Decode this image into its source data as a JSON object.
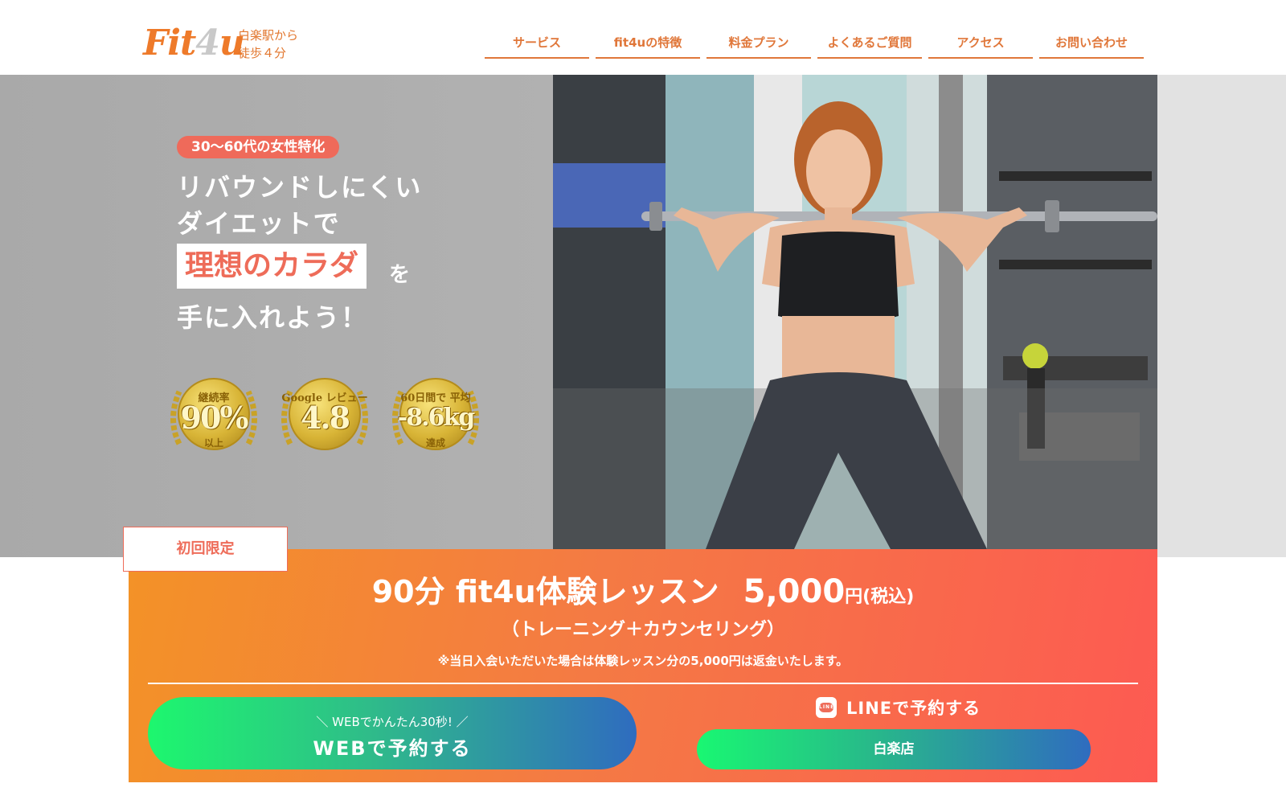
{
  "brand": {
    "logo_main": "Fit",
    "logo_num": "4",
    "logo_end": "u",
    "tagline_1": "白楽駅から",
    "tagline_2": "徒歩４分",
    "accent": "#ee7a2a"
  },
  "nav": [
    "サービス",
    "fit4uの特徴",
    "料金プラン",
    "よくあるご質問",
    "アクセス",
    "お問い合わせ"
  ],
  "hero": {
    "target_badge": "30〜60代の女性特化",
    "line1": "リバウンドしにくい",
    "line2": "ダイエットで",
    "highlight": "理想のカラダ",
    "particle": "を",
    "line4": "手に入れよう！",
    "awards": [
      {
        "top": "継続率",
        "mid": "90%",
        "bot": "以上"
      },
      {
        "top": "Google レビュー",
        "mid": "4.8",
        "bot": ""
      },
      {
        "top": "60日間で 平均",
        "mid": "-8.6kg",
        "bot": "達成"
      }
    ]
  },
  "offer": {
    "first_tag": "初回限定",
    "title": "90分 fit4u体験レッスン",
    "price": "5,000",
    "price_unit": "円(税込)",
    "subtitle": "（トレーニング＋カウンセリング）",
    "note": "※当日入会いただいた場合は体験レッスン分の5,000円は返金いたします。",
    "web_sub": "＼ WEBでかんたん30秒! ／",
    "web_main": "WEBで予約する",
    "line_label": "LINEで予約する",
    "line_icon_text": "LINE",
    "store_btn": "白楽店",
    "colors": {
      "offer_start": "#f39227",
      "offer_end": "#fd5a52",
      "button_start": "#1df76e",
      "button_end": "#2f6cbf"
    }
  }
}
